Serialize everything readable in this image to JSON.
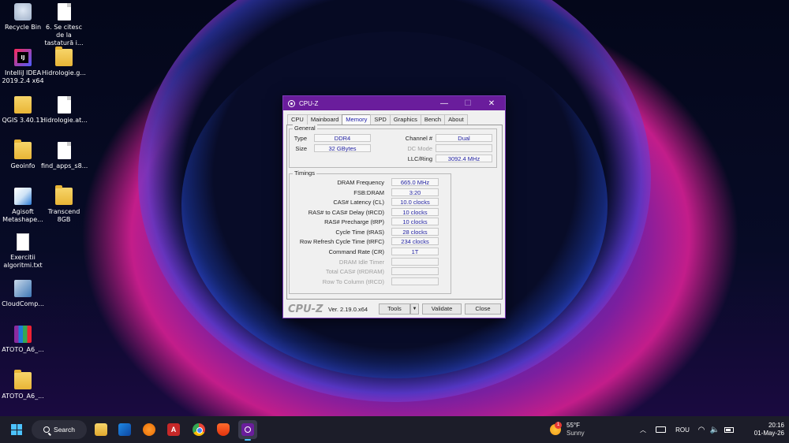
{
  "desktop": {
    "icons": [
      {
        "label": "Recycle Bin",
        "icon": "recycle-bin-icon"
      },
      {
        "label": "6. Se citesc de la tastatură i...",
        "icon": "document-icon"
      },
      {
        "label": "IntelliJ IDEA 2019.2.4 x64",
        "icon": "intellij-idea-icon"
      },
      {
        "label": "Hidrologie.g...",
        "icon": "folder-icon"
      },
      {
        "label": "QGIS 3.40.11",
        "icon": "qgis-icon"
      },
      {
        "label": "Hidrologie.at...",
        "icon": "document-icon"
      },
      {
        "label": "Geoinfo",
        "icon": "folder-icon"
      },
      {
        "label": "find_apps_s8...",
        "icon": "document-icon"
      },
      {
        "label": "Agisoft Metashape...",
        "icon": "agisoft-icon"
      },
      {
        "label": "Transcend 8GB",
        "icon": "folder-icon"
      },
      {
        "label": "Exercitii algoritmi.txt",
        "icon": "text-file-icon"
      },
      {
        "label": "CloudComp...",
        "icon": "cloudcompare-icon"
      },
      {
        "label": "ATOTO_A6_...",
        "icon": "winrar-icon"
      },
      {
        "label": "ATOTO_A6_...",
        "icon": "folder-icon"
      }
    ]
  },
  "window": {
    "title": "CPU-Z",
    "tabs": [
      "CPU",
      "Mainboard",
      "Memory",
      "SPD",
      "Graphics",
      "Bench",
      "About"
    ],
    "active_tab": "Memory",
    "general": {
      "label": "General",
      "type_label": "Type",
      "type_value": "DDR4",
      "size_label": "Size",
      "size_value": "32 GBytes",
      "channel_label": "Channel #",
      "channel_value": "Dual",
      "dcmode_label": "DC Mode",
      "dcmode_value": "",
      "llc_label": "LLC/Ring",
      "llc_value": "3092.4 MHz"
    },
    "timings": {
      "label": "Timings",
      "rows": [
        {
          "label": "DRAM Frequency",
          "value": "665.0 MHz",
          "disabled": false
        },
        {
          "label": "FSB:DRAM",
          "value": "3:20",
          "disabled": false
        },
        {
          "label": "CAS# Latency (CL)",
          "value": "10.0 clocks",
          "disabled": false
        },
        {
          "label": "RAS# to CAS# Delay (tRCD)",
          "value": "10 clocks",
          "disabled": false
        },
        {
          "label": "RAS# Precharge (tRP)",
          "value": "10 clocks",
          "disabled": false
        },
        {
          "label": "Cycle Time (tRAS)",
          "value": "28 clocks",
          "disabled": false
        },
        {
          "label": "Row Refresh Cycle Time (tRFC)",
          "value": "234 clocks",
          "disabled": false
        },
        {
          "label": "Command Rate (CR)",
          "value": "1T",
          "disabled": false
        },
        {
          "label": "DRAM Idle Timer",
          "value": "",
          "disabled": true
        },
        {
          "label": "Total CAS# (tRDRAM)",
          "value": "",
          "disabled": true
        },
        {
          "label": "Row To Column (tRCD)",
          "value": "",
          "disabled": true
        }
      ]
    },
    "footer": {
      "brand": "CPU-Z",
      "version": "Ver. 2.19.0.x64",
      "tools_label": "Tools",
      "tools_arrow": "▼",
      "validate_label": "Validate",
      "close_label": "Close"
    },
    "controls": {
      "minimize": "—",
      "maximize": "☐",
      "close": "✕"
    }
  },
  "taskbar": {
    "search_label": "Search",
    "apps": [
      "file-explorer-icon",
      "mail-icon",
      "blender-icon",
      "autocad-icon",
      "chrome-icon",
      "brave-icon",
      "cpuz-icon"
    ],
    "autocad_glyph": "A",
    "weather": {
      "temp": "55°F",
      "condition": "Sunny",
      "badge": "1"
    },
    "tray": {
      "chevron": "︿",
      "language": "ROU",
      "wifi": "◠",
      "volume": "🔈"
    },
    "clock": {
      "time": "20:16",
      "date": "01-May-26"
    }
  },
  "colors": {
    "accent": "#6a1d9c",
    "value_text": "#1e1ea0",
    "taskbar": "#1c1d29"
  }
}
